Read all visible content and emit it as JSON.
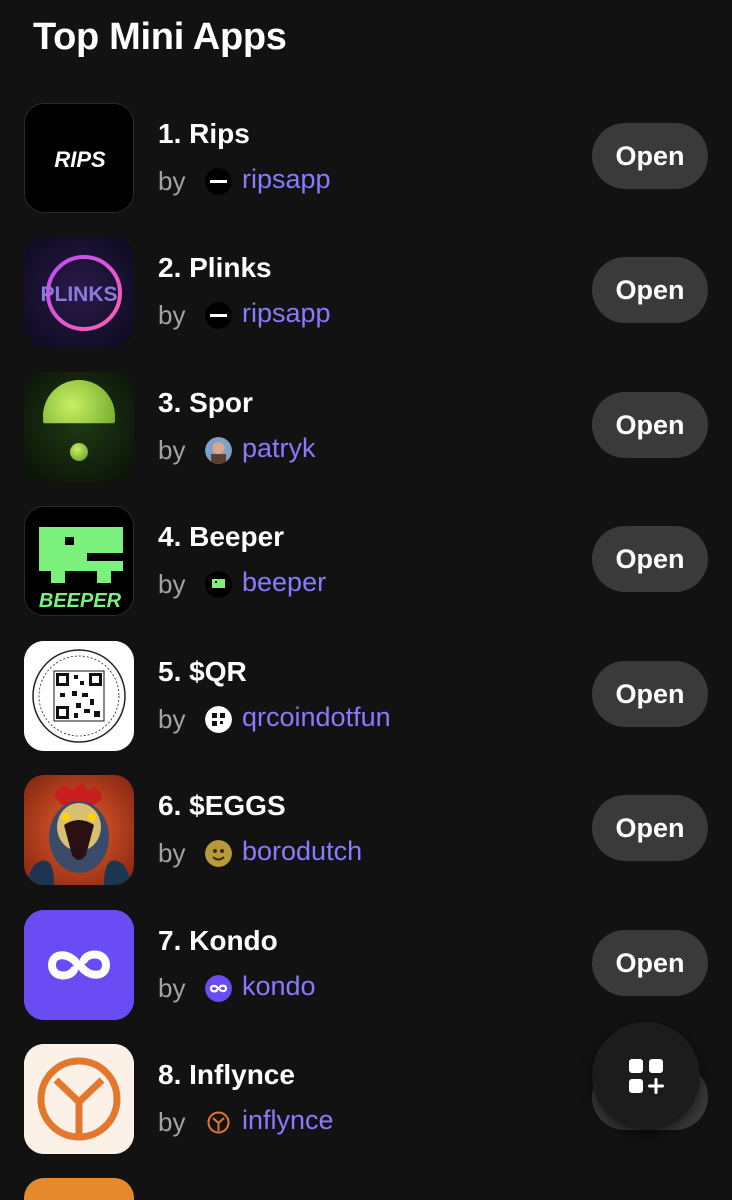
{
  "header": {
    "title": "Top Mini Apps"
  },
  "by_label": "by",
  "apps": [
    {
      "name": "1. Rips",
      "author": "ripsapp",
      "open_label": "Open",
      "icon": "rips-logo-icon",
      "author_icon": "ripsapp-avatar-icon"
    },
    {
      "name": "2. Plinks",
      "author": "ripsapp",
      "open_label": "Open",
      "icon": "plinks-logo-icon",
      "author_icon": "ripsapp-avatar-icon"
    },
    {
      "name": "3. Spor",
      "author": "patryk",
      "open_label": "Open",
      "icon": "spor-logo-icon",
      "author_icon": "patryk-avatar-icon"
    },
    {
      "name": "4. Beeper",
      "author": "beeper",
      "open_label": "Open",
      "icon": "beeper-logo-icon",
      "author_icon": "beeper-avatar-icon"
    },
    {
      "name": "5. $QR",
      "author": "qrcoindotfun",
      "open_label": "Open",
      "icon": "qr-logo-icon",
      "author_icon": "qr-avatar-icon"
    },
    {
      "name": "6. $EGGS",
      "author": "borodutch",
      "open_label": "Open",
      "icon": "rooster-logo-icon",
      "author_icon": "borodutch-avatar-icon"
    },
    {
      "name": "7. Kondo",
      "author": "kondo",
      "open_label": "Open",
      "icon": "kondo-logo-icon",
      "author_icon": "kondo-avatar-icon"
    },
    {
      "name": "8. Inflynce",
      "author": "inflynce",
      "open_label": "Open",
      "icon": "inflynce-logo-icon",
      "author_icon": "inflynce-avatar-icon"
    }
  ],
  "icon_text": {
    "rips": "RIPS",
    "plinks": "PLINKS",
    "beeper": "BEEPER"
  },
  "fab": {
    "icon": "add-app-grid-icon"
  },
  "colors": {
    "background": "#121212",
    "accent_link": "#8b79ff",
    "button_bg": "#3a3a3a",
    "kondo_purple": "#6a4cf5",
    "beeper_green": "#7cf07c",
    "inflynce_orange": "#e4772e"
  }
}
